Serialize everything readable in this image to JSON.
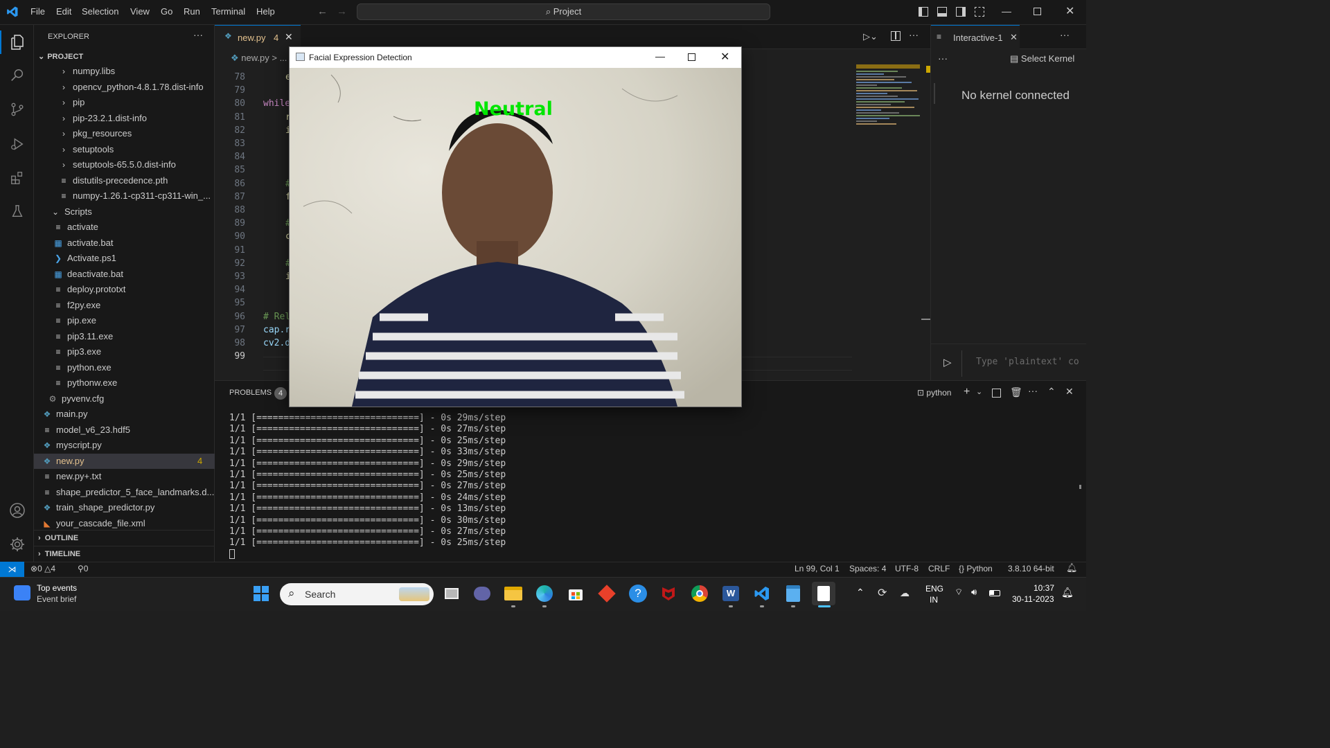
{
  "menu": [
    "File",
    "Edit",
    "Selection",
    "View",
    "Go",
    "Run",
    "Terminal",
    "Help"
  ],
  "command_center": "Project",
  "explorer": {
    "title": "EXPLORER",
    "project": "PROJECT",
    "items": [
      {
        "label": "numpy.libs",
        "type": "folder"
      },
      {
        "label": "opencv_python-4.8.1.78.dist-info",
        "type": "folder"
      },
      {
        "label": "pip",
        "type": "folder"
      },
      {
        "label": "pip-23.2.1.dist-info",
        "type": "folder"
      },
      {
        "label": "pkg_resources",
        "type": "folder"
      },
      {
        "label": "setuptools",
        "type": "folder"
      },
      {
        "label": "setuptools-65.5.0.dist-info",
        "type": "folder"
      },
      {
        "label": "distutils-precedence.pth",
        "type": "file"
      },
      {
        "label": "numpy-1.26.1-cp311-cp311-win_...",
        "type": "file"
      },
      {
        "label": "Scripts",
        "type": "open-folder"
      },
      {
        "label": "activate",
        "type": "file"
      },
      {
        "label": "activate.bat",
        "type": "win"
      },
      {
        "label": "Activate.ps1",
        "type": "ps"
      },
      {
        "label": "deactivate.bat",
        "type": "win"
      },
      {
        "label": "deploy.prototxt",
        "type": "file"
      },
      {
        "label": "f2py.exe",
        "type": "file"
      },
      {
        "label": "pip.exe",
        "type": "file"
      },
      {
        "label": "pip3.11.exe",
        "type": "file"
      },
      {
        "label": "pip3.exe",
        "type": "file"
      },
      {
        "label": "python.exe",
        "type": "file"
      },
      {
        "label": "pythonw.exe",
        "type": "file"
      },
      {
        "label": "pyvenv.cfg",
        "type": "gear"
      },
      {
        "label": "main.py",
        "type": "py"
      },
      {
        "label": "model_v6_23.hdf5",
        "type": "file"
      },
      {
        "label": "myscript.py",
        "type": "py"
      },
      {
        "label": "new.py",
        "type": "py",
        "badge": "4"
      },
      {
        "label": "new.py+.txt",
        "type": "file"
      },
      {
        "label": "shape_predictor_5_face_landmarks.d...",
        "type": "file"
      },
      {
        "label": "train_shape_predictor.py",
        "type": "py"
      },
      {
        "label": "your_cascade_file.xml",
        "type": "rss"
      }
    ],
    "outline": "OUTLINE",
    "timeline": "TIMELINE"
  },
  "editor": {
    "tab_label": "new.py",
    "tab_badge": "4",
    "breadcrumb": "new.py >  ...",
    "line_numbers": [
      "78",
      "79",
      "80",
      "81",
      "82",
      "83",
      "84",
      "85",
      "86",
      "87",
      "88",
      "89",
      "90",
      "91",
      "92",
      "93",
      "94",
      "95",
      "96",
      "97",
      "98",
      "99"
    ],
    "code_lines": [
      "e",
      "",
      "while",
      "r",
      "i",
      "",
      "",
      "",
      "#",
      "f",
      "",
      "#",
      "c",
      "",
      "#",
      "i",
      "",
      "",
      "# Rel",
      "cap.r",
      "cv2.d",
      ""
    ]
  },
  "interactive": {
    "tab_label": "Interactive-1",
    "select_kernel": "Select Kernel",
    "no_kernel": "No kernel connected",
    "input_placeholder": "Type 'plaintext' co"
  },
  "panel": {
    "problems_label": "PROBLEMS",
    "problems_count": "4",
    "shell_label": "python",
    "terminal_lines": [
      "1/1 [==============================] - 0s 29ms/step",
      "1/1 [==============================] - 0s 27ms/step",
      "1/1 [==============================] - 0s 25ms/step",
      "1/1 [==============================] - 0s 33ms/step",
      "1/1 [==============================] - 0s 29ms/step",
      "1/1 [==============================] - 0s 25ms/step",
      "1/1 [==============================] - 0s 27ms/step",
      "1/1 [==============================] - 0s 24ms/step",
      "1/1 [==============================] - 0s 13ms/step",
      "1/1 [==============================] - 0s 30ms/step",
      "1/1 [==============================] - 0s 27ms/step",
      "1/1 [==============================] - 0s 25ms/step"
    ]
  },
  "status": {
    "errors": "0",
    "warnings": "4",
    "ports": "0",
    "position": "Ln 99, Col 1",
    "spaces": "Spaces: 4",
    "encoding": "UTF-8",
    "eol": "CRLF",
    "language": "Python",
    "interpreter": "3.8.10 64-bit"
  },
  "cv_window": {
    "title": "Facial Expression Detection",
    "expression": "Neutral"
  },
  "taskbar": {
    "widget_title": "Top events",
    "widget_sub": "Event brief",
    "search": "Search",
    "lang_top": "ENG",
    "lang_bottom": "IN",
    "time": "10:37",
    "date": "30-11-2023"
  },
  "colors": {
    "accent": "#0078d4",
    "python_blue": "#519aba",
    "expression_green": "#00e600",
    "badge_yellow": "#cca700"
  }
}
